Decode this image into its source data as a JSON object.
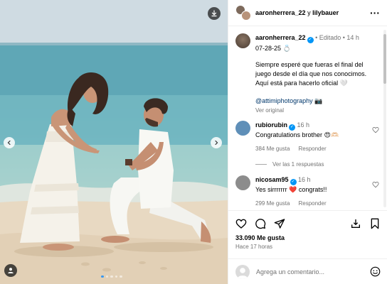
{
  "header": {
    "user1": "aaronherrera_22",
    "conj": "y",
    "user2": "lilybauer"
  },
  "caption": {
    "username": "aaronherrera_22",
    "edited": "Editado",
    "time": "14 h",
    "date": "07-28-25 💍",
    "text": "Siempre esperé que fueras el final del juego desde el día que nos conocimos. Aquí está para hacerlo oficial 🤍",
    "mention": "@attimiphotography 📷",
    "translate": "Ver original"
  },
  "comments": [
    {
      "username": "rubiorubin",
      "time": "16 h",
      "text": "Congratulations brother 😍🫶🏻",
      "likes": "384 Me gusta",
      "reply": "Responder",
      "avatar_color": "#5f8fb8"
    },
    {
      "username": "nicosam95",
      "time": "16 h",
      "text": "Yes sirrrrrrr ❤️ congrats!!",
      "likes": "299 Me gusta",
      "reply": "Responder",
      "avatar_color": "#8c8c8c"
    }
  ],
  "replies_label": "Ver las 1 respuestas",
  "post": {
    "likes": "33.090 Me gusta",
    "time_ago": "Hace 17 horas"
  },
  "compose": {
    "placeholder": "Agrega un comentario..."
  },
  "carousel": {
    "slides": 5,
    "active_index": 0
  },
  "colors": {
    "verified": "#0095f6",
    "link": "#00376b",
    "muted": "#737373",
    "active_dot": "#3897f0"
  },
  "icons": [
    "download-icon",
    "chevron-left-icon",
    "chevron-right-icon",
    "user-tag-icon",
    "more-icon",
    "verified-icon",
    "heart-icon",
    "comment-icon",
    "share-icon",
    "bookmark-icon",
    "gif-icon",
    "emoji-icon"
  ]
}
